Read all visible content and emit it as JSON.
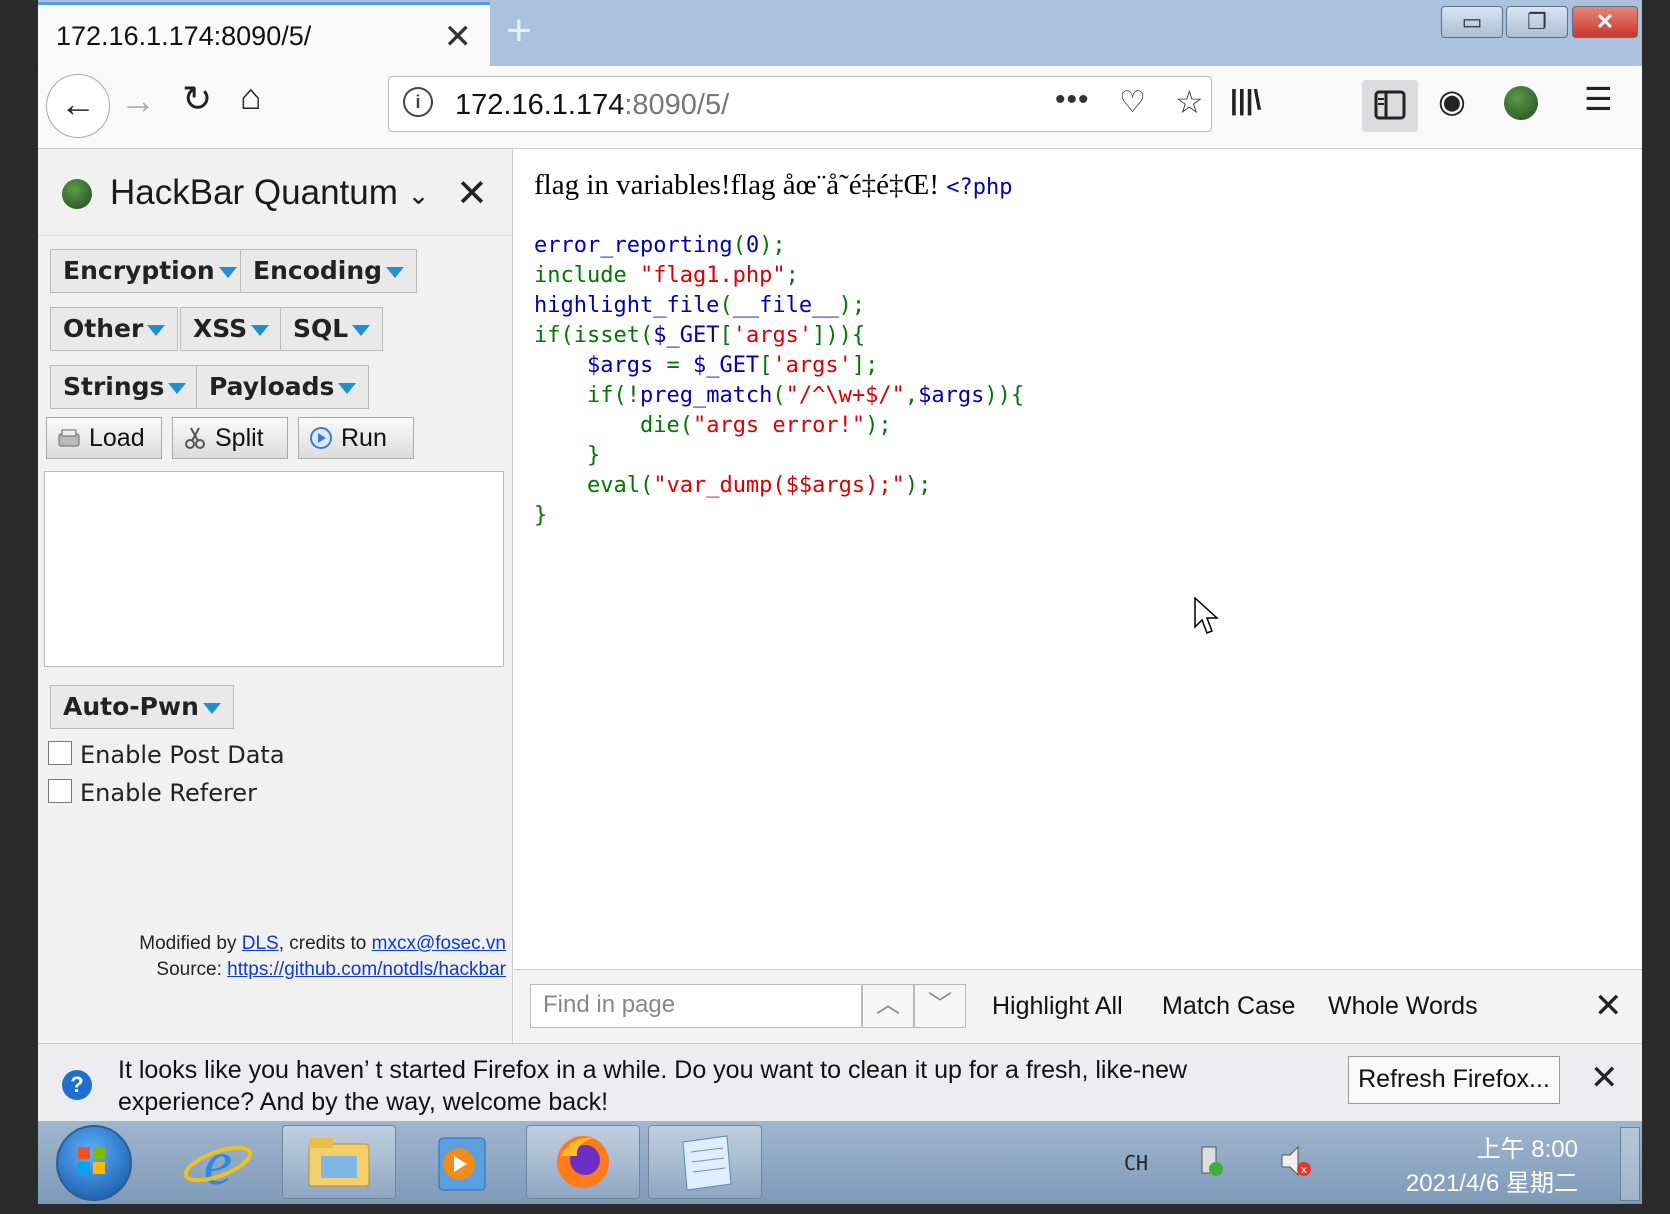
{
  "tab": {
    "title": "172.16.1.174:8090/5/",
    "close": "✕",
    "new": "+"
  },
  "window_controls": {
    "minimize": "▭",
    "maximize": "❐",
    "close": "✕"
  },
  "nav": {
    "back": "←",
    "forward": "→",
    "reload": "↻",
    "home": "⌂"
  },
  "url": {
    "host": "172.16.1.174",
    "rest": ":8090/5/",
    "info": "i",
    "more": "•••",
    "pocket": "♡",
    "star": "☆"
  },
  "toolbar": {
    "library": "|||\\",
    "account": "◉",
    "menu": "☰"
  },
  "hackbar": {
    "title": "HackBar Quantum",
    "title_caret": "⌄",
    "close": "✕",
    "menus": [
      "Encryption",
      "Encoding",
      "Other",
      "XSS",
      "SQL",
      "Strings",
      "Payloads"
    ],
    "load": "Load",
    "split": "Split",
    "run": "Run",
    "textarea_value": "",
    "autopwn": "Auto-Pwn",
    "enable_post": "Enable Post Data",
    "enable_referer": "Enable Referer",
    "footer_modified": "Modified by ",
    "footer_dls": "DLS",
    "footer_credits": ", credits to ",
    "footer_mxcx": "mxcx@fosec.vn",
    "footer_source": "Source: ",
    "footer_url": "https://github.com/notdls/hackbar"
  },
  "content": {
    "head_text": "flag in variables!flag åœ¨å˜é‡é‡Œ!",
    "php_open": "<?php",
    "code": {
      "l1a": "error_reporting",
      "l1b": "(",
      "l1c": "0",
      "l1d": ");",
      "l2a": "include ",
      "l2b": "\"flag1.php\"",
      "l2c": ";",
      "l3a": "highlight_file",
      "l3b": "(",
      "l3c": "__file__",
      "l3d": ");",
      "l4a": "if(isset(",
      "l4b": "$_GET",
      "l4c": "[",
      "l4d": "'args'",
      "l4e": "])){",
      "l5a": "    $args ",
      "l5b": "= ",
      "l5c": "$_GET",
      "l5d": "[",
      "l5e": "'args'",
      "l5f": "];",
      "l6a": "    if(!",
      "l6b": "preg_match",
      "l6c": "(",
      "l6d": "\"/^\\w+$/\"",
      "l6e": ",",
      "l6f": "$args",
      "l6g": ")){",
      "l7a": "        die(",
      "l7b": "\"args error!\"",
      "l7c": ");",
      "l8a": "    }",
      "l9a": "    eval(",
      "l9b": "\"var_dump($$args);\"",
      "l9c": ");",
      "l10a": "}"
    }
  },
  "findbar": {
    "placeholder": "Find in page",
    "value": "",
    "up": "︿",
    "down": "﹀",
    "highlight_all": "Highlight All",
    "match_case": "Match Case",
    "whole_words": "Whole Words",
    "close": "✕"
  },
  "notification": {
    "icon": "?",
    "text": "It looks like you haven’ t started Firefox in a while. Do you want to clean it up for a fresh, like-new experience? And by the way, welcome back!",
    "button": "Refresh Firefox...",
    "close": "✕"
  },
  "taskbar": {
    "lang": "CH",
    "time": "上午 8:00",
    "date": "2021/4/6 星期二"
  },
  "colors": {
    "accent_tab": "#4e9ef0",
    "hackbar_caret": "#1f8fd6",
    "php_keyword": "#0000bb",
    "php_string": "#dd0000",
    "php_punct": "#007700"
  }
}
